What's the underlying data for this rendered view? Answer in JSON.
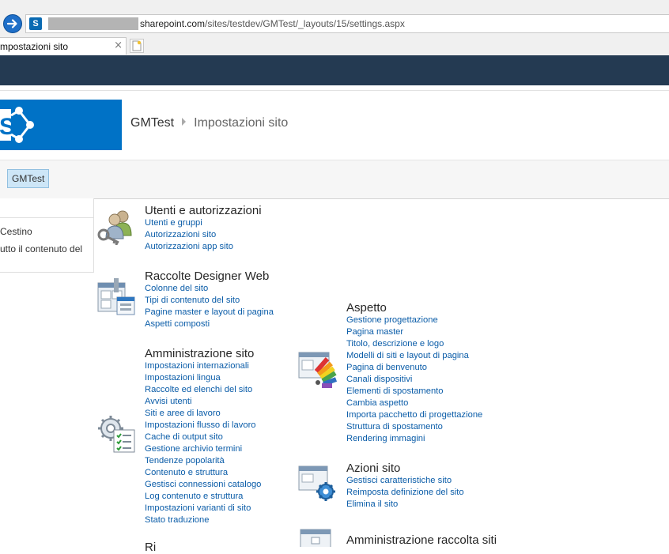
{
  "browser": {
    "url_host": "sharepoint.com",
    "url_path": "/sites/testdev/GMTest/_layouts/15/settings.aspx",
    "tab_title": "mpostazioni sito",
    "favicon_letter": "S",
    "tab_close": "×"
  },
  "header": {
    "site_title": "GMTest",
    "page_title": "Impostazioni sito"
  },
  "topnav": {
    "item": "GMTest"
  },
  "quicklaunch": {
    "items": [
      "Cestino",
      "utto il contenuto del"
    ]
  },
  "groups": {
    "users": {
      "title": "Utenti e autorizzazioni",
      "links": [
        "Utenti e gruppi",
        "Autorizzazioni sito",
        "Autorizzazioni app sito"
      ]
    },
    "designer": {
      "title": "Raccolte Designer Web",
      "links": [
        "Colonne del sito",
        "Tipi di contenuto del sito",
        "Pagine master e layout di pagina",
        "Aspetti composti"
      ]
    },
    "admin": {
      "title": "Amministrazione sito",
      "links": [
        "Impostazioni internazionali",
        "Impostazioni lingua",
        "Raccolte ed elenchi del sito",
        "Avvisi utenti",
        "Siti e aree di lavoro",
        "Impostazioni flusso di lavoro",
        "Cache di output sito",
        "Gestione archivio termini",
        "Tendenze popolarità",
        "Contenuto e struttura",
        "Gestisci connessioni catalogo",
        "Log contenuto e struttura",
        "Impostazioni varianti di sito",
        "Stato traduzione"
      ]
    },
    "look": {
      "title": "Aspetto",
      "links": [
        "Gestione progettazione",
        "Pagina master",
        "Titolo, descrizione e logo",
        "Modelli di siti e layout di pagina",
        "Pagina di benvenuto",
        "Canali dispositivi",
        "Elementi di spostamento",
        "Cambia aspetto",
        "Importa pacchetto di progettazione",
        "Struttura di spostamento",
        "Rendering immagini"
      ]
    },
    "actions": {
      "title": "Azioni sito",
      "links": [
        "Gestisci caratteristiche sito",
        "Reimposta definizione del sito",
        "Elimina il sito"
      ]
    },
    "collection": {
      "title": "Amministrazione raccolta siti"
    },
    "partial": {
      "title": "Ri"
    }
  },
  "colors": {
    "suite_bar": "#243a52",
    "brand": "#0072c6",
    "link": "#0a5ca8"
  }
}
